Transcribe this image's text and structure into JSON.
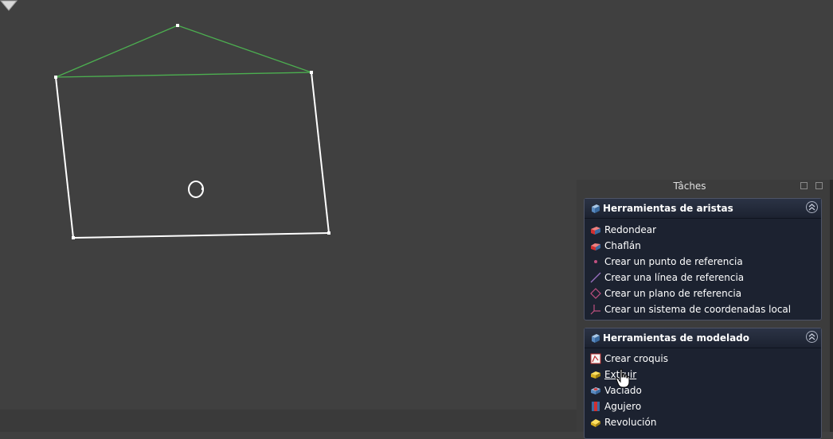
{
  "panel": {
    "title": "Tâches"
  },
  "edge_tools": {
    "title": "Herramientas de aristas",
    "items": [
      {
        "label": "Redondear",
        "icon": "fillet-icon"
      },
      {
        "label": "Chaflán",
        "icon": "chamfer-icon"
      },
      {
        "label": "Crear un punto de referencia",
        "icon": "datum-point-icon"
      },
      {
        "label": "Crear una línea de referencia",
        "icon": "datum-line-icon"
      },
      {
        "label": "Crear un plano de referencia",
        "icon": "datum-plane-icon"
      },
      {
        "label": "Crear un sistema de coordenadas local",
        "icon": "local-coordinate-system-icon"
      }
    ]
  },
  "modeling_tools": {
    "title": "Herramientas de modelado",
    "items": [
      {
        "label": "Crear croquis",
        "icon": "sketch-icon"
      },
      {
        "label": "Extruir",
        "icon": "pad-icon"
      },
      {
        "label": "Vaciado",
        "icon": "pocket-icon"
      },
      {
        "label": "Agujero",
        "icon": "hole-icon"
      },
      {
        "label": "Revolución",
        "icon": "revolution-icon"
      }
    ]
  },
  "colors": {
    "viewport_bg": "#404040",
    "sketch_line": "#ffffff",
    "constraint_line": "#4caf50",
    "taskbox_bg": "#1c2230"
  }
}
